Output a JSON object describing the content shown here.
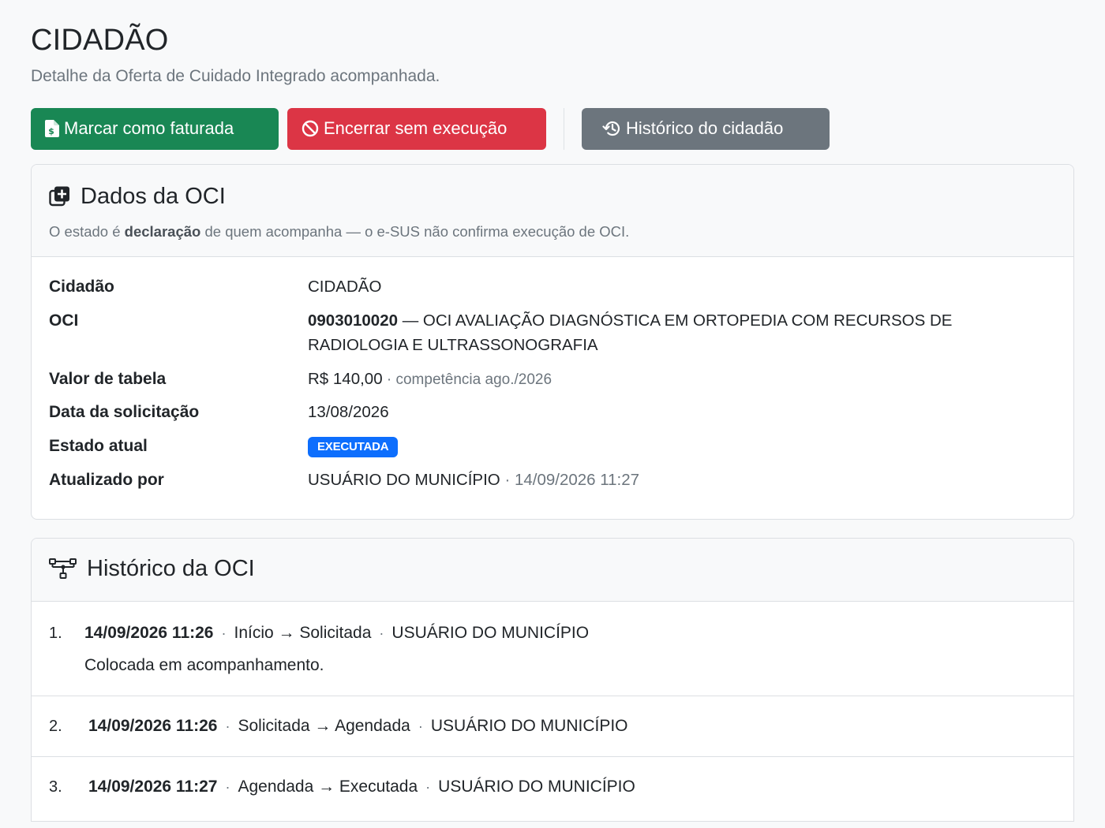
{
  "header": {
    "title": "CIDADÃO",
    "subtitle": "Detalhe da Oferta de Cuidado Integrado acompanhada."
  },
  "toolbar": {
    "mark_billed_label": "Marcar como faturada",
    "close_no_exec_label": "Encerrar sem execução",
    "citizen_history_label": "Histórico do cidadão"
  },
  "oci_card": {
    "title": "Dados da OCI",
    "desc_prefix": "O estado é ",
    "desc_bold": "declaração",
    "desc_suffix": " de quem acompanha — o e-SUS não confirma execução de OCI.",
    "fields": {
      "cidadao_label": "Cidadão",
      "cidadao_value": "CIDADÃO",
      "oci_label": "OCI",
      "oci_code": "0903010020",
      "oci_desc": " — OCI AVALIAÇÃO DIAGNÓSTICA EM ORTOPEDIA COM RECURSOS DE RADIOLOGIA E ULTRASSONOGRAFIA",
      "valor_label": "Valor de tabela",
      "valor_value": "R$ 140,00",
      "valor_competencia": " · competência ago./2026",
      "data_label": "Data da solicitação",
      "data_value": "13/08/2026",
      "estado_label": "Estado atual",
      "estado_value": "EXECUTADA",
      "atualizado_label": "Atualizado por",
      "atualizado_user": "USUÁRIO DO MUNICÍPIO",
      "atualizado_when": " · 14/09/2026 11:27"
    }
  },
  "history_card": {
    "title": "Histórico da OCI",
    "separator": "·",
    "items": [
      {
        "num": "1.",
        "date": "14/09/2026 11:26",
        "transition": "Início → Solicitada",
        "user": "USUÁRIO DO MUNICÍPIO",
        "note": "Colocada em acompanhamento."
      },
      {
        "num": "2.",
        "date": "14/09/2026 11:26",
        "transition": "Solicitada → Agendada",
        "user": "USUÁRIO DO MUNICÍPIO"
      },
      {
        "num": "3.",
        "date": "14/09/2026 11:27",
        "transition": "Agendada → Executada",
        "user": "USUÁRIO DO MUNICÍPIO"
      }
    ]
  },
  "colors": {
    "success": "#198754",
    "danger": "#dc3545",
    "secondary": "#6c757d",
    "badge": "#0d6efd"
  },
  "icons": {
    "mark_billed": "file-dollar-icon",
    "close_no_exec": "ban-icon",
    "citizen_history": "clock-history-icon",
    "oci_card": "plus-square-stack-icon",
    "history_card": "diagram-nodes-icon"
  }
}
